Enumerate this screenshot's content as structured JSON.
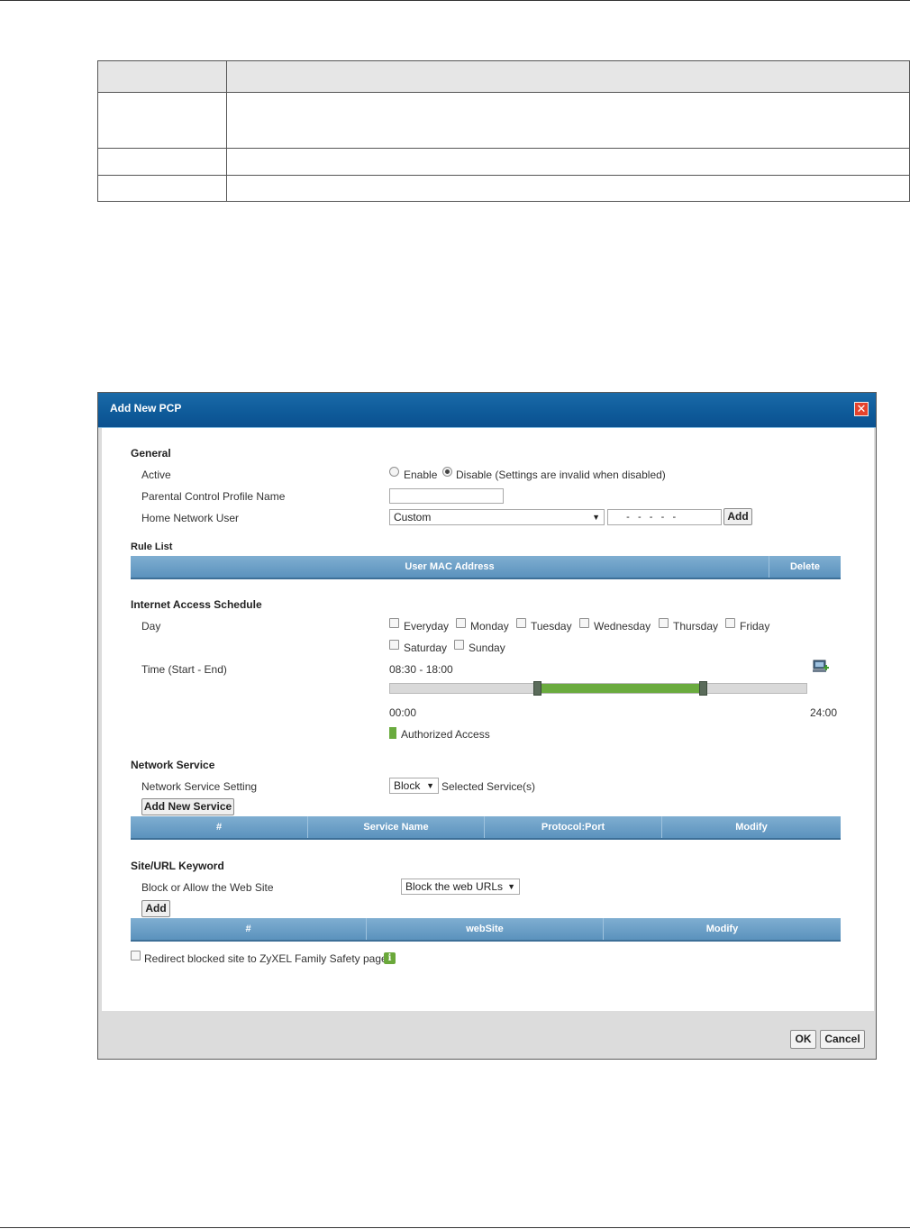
{
  "doc_table": {
    "rows": [
      {
        "c1": "",
        "c2": ""
      },
      {
        "c1": "",
        "c2": ""
      },
      {
        "c1": "",
        "c2": ""
      },
      {
        "c1": "",
        "c2": ""
      }
    ]
  },
  "dialog": {
    "title": "Add New PCP",
    "general": {
      "heading": "General",
      "active_label": "Active",
      "enable_label": "Enable",
      "disable_label": "Disable (Settings are invalid when disabled)",
      "active_selected": "Disable",
      "profile_name_label": "Parental Control Profile Name",
      "profile_name_value": "",
      "home_user_label": "Home Network User",
      "home_user_selected": "Custom",
      "mac_placeholder": "  -   -   -   -   -  ",
      "add_label": "Add"
    },
    "rule_list": {
      "heading": "Rule List",
      "columns": [
        "User MAC Address",
        "Delete"
      ]
    },
    "schedule": {
      "heading": "Internet Access Schedule",
      "day_label": "Day",
      "days": [
        "Everyday",
        "Monday",
        "Tuesday",
        "Wednesday",
        "Thursday",
        "Friday",
        "Saturday",
        "Sunday"
      ],
      "time_label": "Time (Start - End)",
      "time_value": "08:30 - 18:00",
      "scale_start": "00:00",
      "scale_end": "24:00",
      "range_start_hours": 8.5,
      "range_end_hours": 18.0,
      "legend": "Authorized Access",
      "accent_color": "#6aab3e"
    },
    "network_service": {
      "heading": "Network Service",
      "setting_label": "Network Service Setting",
      "setting_selected": "Block",
      "selected_services_text": "Selected Service(s)",
      "add_service_label": "Add New Service",
      "columns": [
        "#",
        "Service Name",
        "Protocol:Port",
        "Modify"
      ]
    },
    "site_keyword": {
      "heading": "Site/URL Keyword",
      "block_allow_label": "Block or Allow the Web Site",
      "block_allow_selected": "Block the web URLs",
      "add_label": "Add",
      "columns": [
        "#",
        "webSite",
        "Modify"
      ],
      "redirect_label": "Redirect blocked site to ZyXEL Family Safety page"
    },
    "footer": {
      "ok_label": "OK",
      "cancel_label": "Cancel"
    }
  }
}
